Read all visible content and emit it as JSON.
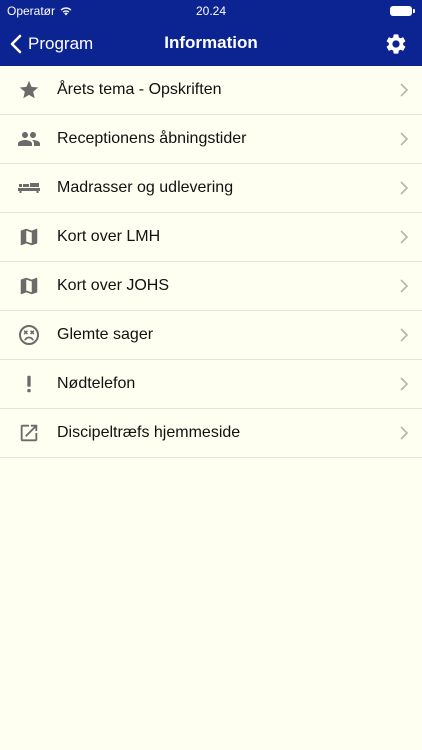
{
  "status_bar": {
    "carrier": "Operatør",
    "time": "20.24"
  },
  "nav": {
    "back_label": "Program",
    "title": "Information",
    "settings_icon": "gear-icon"
  },
  "items": [
    {
      "label": "Årets tema - Opskriften",
      "icon": "star-icon"
    },
    {
      "label": "Receptionens åbningstider",
      "icon": "people-icon"
    },
    {
      "label": "Madrasser og udlevering",
      "icon": "bed-icon"
    },
    {
      "label": "Kort over LMH",
      "icon": "map-icon"
    },
    {
      "label": "Kort over JOHS",
      "icon": "map-icon"
    },
    {
      "label": "Glemte sager",
      "icon": "sad-face-icon"
    },
    {
      "label": "Nødtelefon",
      "icon": "exclamation-icon"
    },
    {
      "label": "Discipeltræfs hjemmeside",
      "icon": "open-in-new-icon"
    }
  ],
  "colors": {
    "header": "#0c2392",
    "background": "#fefff0",
    "icon": "#6b6b6b",
    "chevron": "#b9b9b0"
  }
}
